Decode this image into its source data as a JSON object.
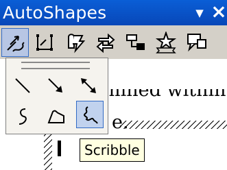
{
  "document": {
    "line1": "mined within",
    "line2": "e."
  },
  "toolbar": {
    "title": "AutoShapes",
    "menu_glyph": "▼",
    "close_glyph": "×",
    "buttons": [
      {
        "name": "lines",
        "icon": "lines-icon",
        "pressed": true
      },
      {
        "name": "connectors",
        "icon": "connectors-icon",
        "pressed": false
      },
      {
        "name": "basic-shapes",
        "icon": "basic-shapes-icon",
        "pressed": false
      },
      {
        "name": "block-arrows",
        "icon": "block-arrows-icon",
        "pressed": false
      },
      {
        "name": "flowchart",
        "icon": "flowchart-icon",
        "pressed": false
      },
      {
        "name": "stars-and-banners",
        "icon": "stars-banners-icon",
        "pressed": false
      },
      {
        "name": "callouts",
        "icon": "callouts-icon",
        "pressed": false
      }
    ]
  },
  "lines_menu": {
    "items": [
      {
        "name": "line",
        "icon": "line-icon"
      },
      {
        "name": "arrow",
        "icon": "arrow-icon"
      },
      {
        "name": "double-arrow",
        "icon": "double-arrow-icon"
      },
      {
        "name": "curve",
        "icon": "curve-icon"
      },
      {
        "name": "freeform",
        "icon": "freeform-icon"
      },
      {
        "name": "scribble",
        "icon": "scribble-icon",
        "hovered": true
      }
    ]
  },
  "tooltip": {
    "text": "Scribble"
  },
  "colors": {
    "titlebar": "#0a5ed6",
    "toolbar_bg": "#d4d0c8",
    "menu_bg": "#f5f3ee",
    "highlight": "#c1d2ee",
    "highlight_border": "#316ac5",
    "tooltip_bg": "#ffffe1"
  }
}
